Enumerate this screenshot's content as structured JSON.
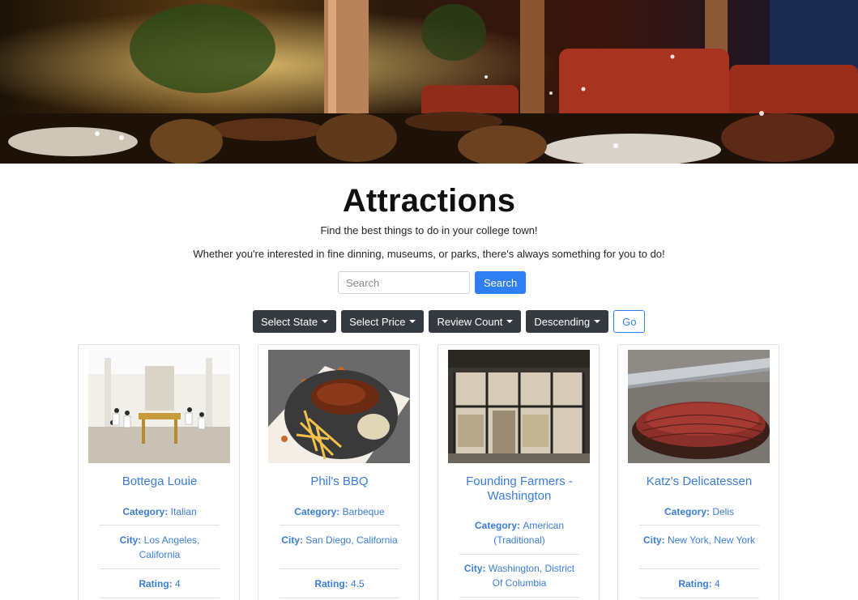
{
  "page": {
    "title": "Attractions",
    "subtitle": "Find the best things to do in your college town!",
    "description": "Whether you're interested in fine dinning, museums, or parks, there's always something for you to do!"
  },
  "search": {
    "placeholder": "Search",
    "button_label": "Search"
  },
  "filters": {
    "state_label": "Select State",
    "price_label": "Select Price",
    "review_label": "Review Count",
    "order_label": "Descending",
    "go_label": "Go"
  },
  "labels": {
    "category": "Category:",
    "city": "City:",
    "rating": "Rating:"
  },
  "cards": [
    {
      "name": "Bottega Louie",
      "category": "Italian",
      "city": "Los Angeles, California",
      "rating": "4",
      "image_icon": "dining-hall-photo"
    },
    {
      "name": "Phil's BBQ",
      "category": "Barbeque",
      "city": "San Diego, California",
      "rating": "4.5",
      "image_icon": "bbq-plate-photo"
    },
    {
      "name": "Founding Farmers - Washington",
      "category": "American (Traditional)",
      "city": "Washington, District Of Columbia",
      "rating": "",
      "image_icon": "storefront-photo"
    },
    {
      "name": "Katz's Delicatessen",
      "category": "Delis",
      "city": "New York, New York",
      "rating": "4",
      "image_icon": "sliced-meat-photo"
    }
  ],
  "colors": {
    "primary": "#2f7ef2",
    "dark_button": "#343a40",
    "link": "#3a7dd8"
  }
}
